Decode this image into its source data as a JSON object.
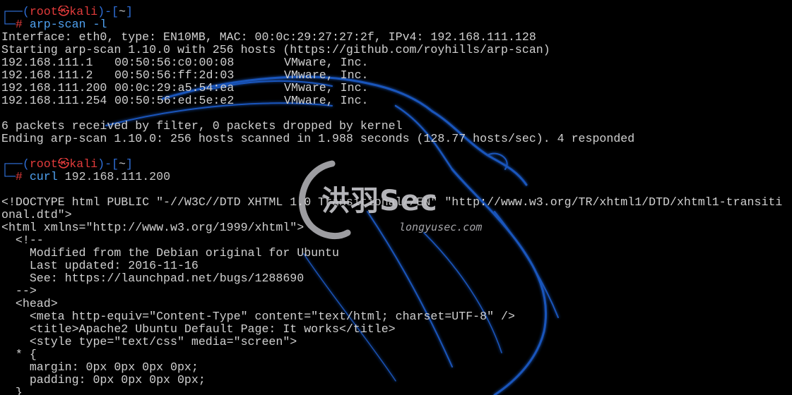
{
  "prompt": {
    "user": "root",
    "at": "㉿",
    "host": "kali",
    "dir": "~"
  },
  "commands": {
    "first": {
      "cmd": "arp-scan",
      "args": "-l"
    },
    "second": {
      "cmd": "curl",
      "args": "192.168.111.200"
    }
  },
  "scan_output": {
    "interface_line": "Interface: eth0, type: EN10MB, MAC: 00:0c:29:27:27:2f, IPv4: 192.168.111.128",
    "start_line": "Starting arp-scan 1.10.0 with 256 hosts (https://github.com/royhills/arp-scan)",
    "hosts": [
      {
        "ip": "192.168.111.1",
        "mac": "00:50:56:c0:00:08",
        "vendor": "VMware, Inc."
      },
      {
        "ip": "192.168.111.2",
        "mac": "00:50:56:ff:2d:03",
        "vendor": "VMware, Inc."
      },
      {
        "ip": "192.168.111.200",
        "mac": "00:0c:29:a5:54:ea",
        "vendor": "VMware, Inc."
      },
      {
        "ip": "192.168.111.254",
        "mac": "00:50:56:ed:5e:e2",
        "vendor": "VMware, Inc."
      }
    ],
    "packets_line": "6 packets received by filter, 0 packets dropped by kernel",
    "end_line": "Ending arp-scan 1.10.0: 256 hosts scanned in 1.988 seconds (128.77 hosts/sec). 4 responded"
  },
  "curl_output": [
    "<!DOCTYPE html PUBLIC \"-//W3C//DTD XHTML 1.0 Transitional//EN\" \"http://www.w3.org/TR/xhtml1/DTD/xhtml1-transiti",
    "onal.dtd\">",
    "<html xmlns=\"http://www.w3.org/1999/xhtml\">",
    "  <!--",
    "    Modified from the Debian original for Ubuntu",
    "    Last updated: 2016-11-16",
    "    See: https://launchpad.net/bugs/1288690",
    "  -->",
    "  <head>",
    "    <meta http-equiv=\"Content-Type\" content=\"text/html; charset=UTF-8\" />",
    "    <title>Apache2 Ubuntu Default Page: It works</title>",
    "    <style type=\"text/css\" media=\"screen\">",
    "  * {",
    "    margin: 0px 0px 0px 0px;",
    "    padding: 0px 0px 0px 0px;",
    "  }"
  ],
  "watermark": {
    "title": "洪羽Sec",
    "url": "longyusec.com"
  },
  "colors": {
    "background": "#000000",
    "prompt_frame": "#2f6fd8",
    "prompt_user": "#e23b3b",
    "command": "#4fa1f0",
    "text": "#d0d0d0"
  }
}
